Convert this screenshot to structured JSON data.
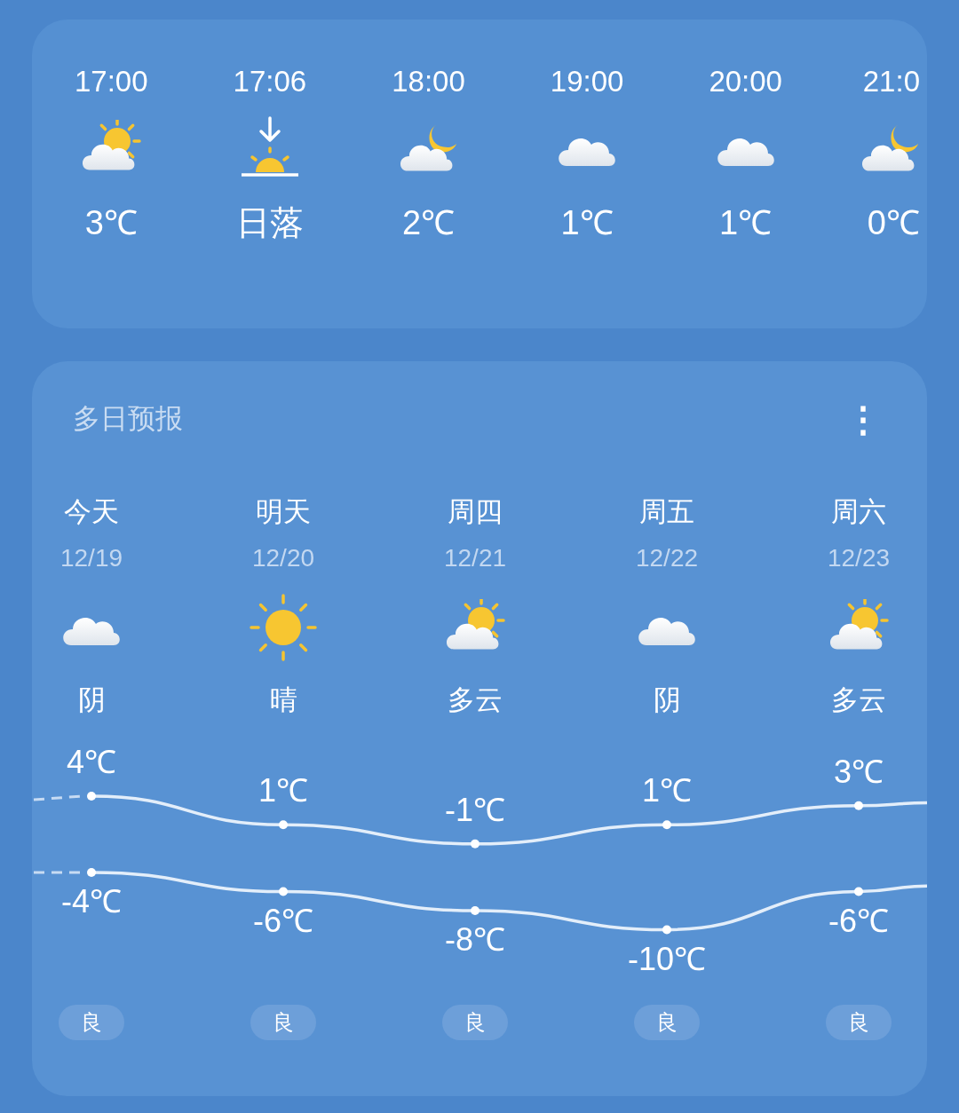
{
  "hourly": [
    {
      "time": "17:00",
      "kind": "partly_cloudy",
      "value": "3℃"
    },
    {
      "time": "17:06",
      "kind": "sunset",
      "value": "日落"
    },
    {
      "time": "18:00",
      "kind": "night_cloudy",
      "value": "2℃"
    },
    {
      "time": "19:00",
      "kind": "cloudy",
      "value": "1℃"
    },
    {
      "time": "20:00",
      "kind": "cloudy",
      "value": "1℃"
    },
    {
      "time": "21:0",
      "kind": "night_cloudy",
      "value": "0℃"
    }
  ],
  "forecast": {
    "title": "多日预报",
    "menu": "⋮",
    "days": [
      {
        "day": "今天",
        "date": "12/19",
        "kind": "cloudy",
        "condition": "阴",
        "high": "4℃",
        "low": "-4℃",
        "air": "良"
      },
      {
        "day": "明天",
        "date": "12/20",
        "kind": "sunny",
        "condition": "晴",
        "high": "1℃",
        "low": "-6℃",
        "air": "良"
      },
      {
        "day": "周四",
        "date": "12/21",
        "kind": "partly_cloudy",
        "condition": "多云",
        "high": "-1℃",
        "low": "-8℃",
        "air": "良"
      },
      {
        "day": "周五",
        "date": "12/22",
        "kind": "cloudy",
        "condition": "阴",
        "high": "1℃",
        "low": "-10℃",
        "air": "良"
      },
      {
        "day": "周六",
        "date": "12/23",
        "kind": "partly_cloudy",
        "condition": "多云",
        "high": "3℃",
        "low": "-6℃",
        "air": "良"
      }
    ]
  }
}
